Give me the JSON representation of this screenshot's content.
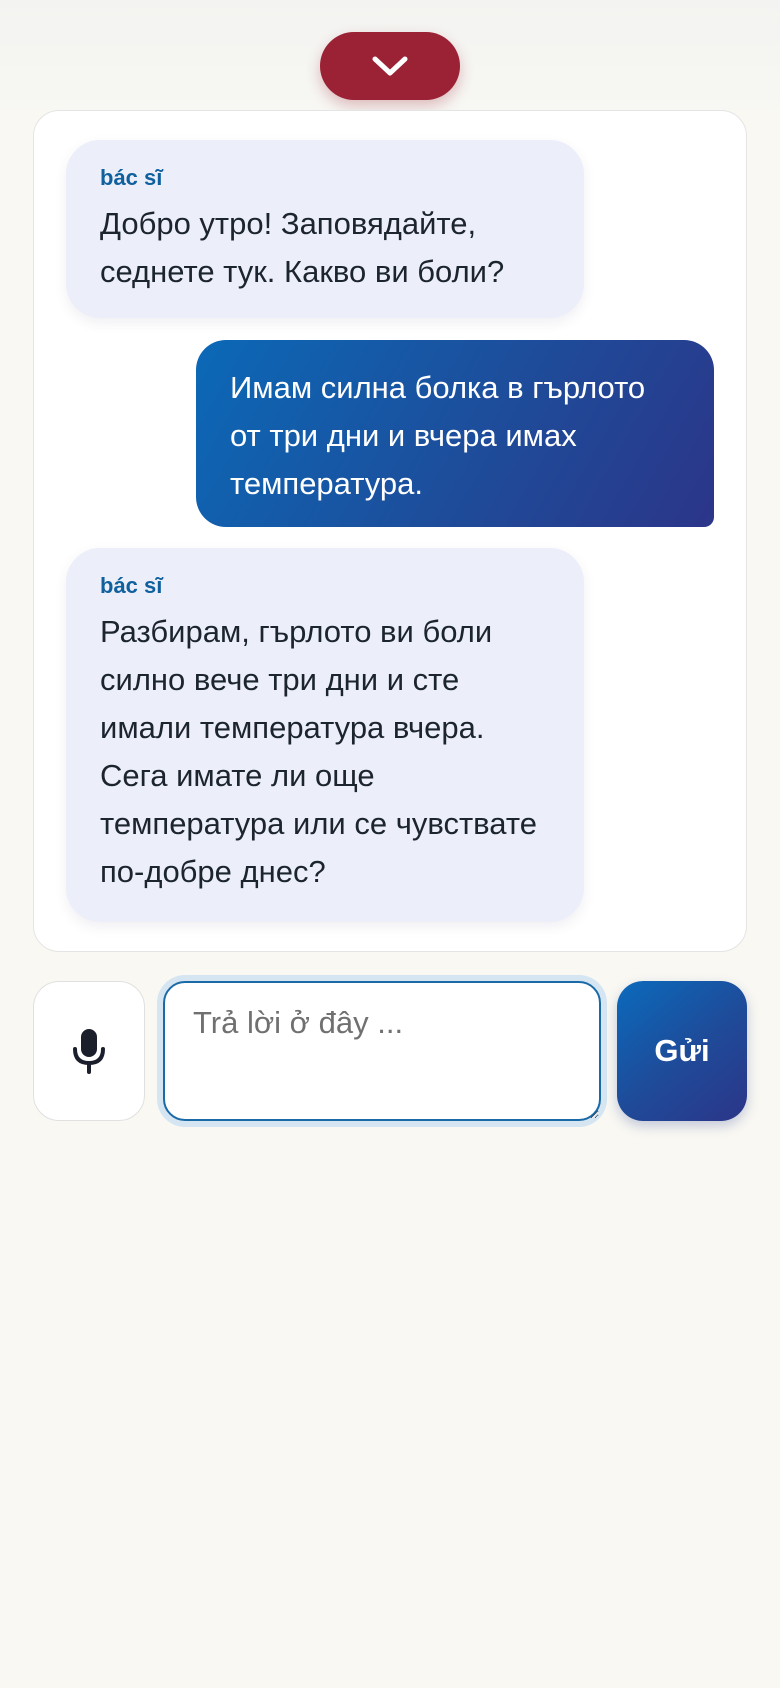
{
  "header": {
    "collapse_icon": "chevron-down-icon"
  },
  "conversation": {
    "messages": [
      {
        "role": "doctor",
        "sender": "bác sĩ",
        "text": "Добро утро! Заповядайте, седнете тук. Какво ви боли?"
      },
      {
        "role": "user",
        "text": "Имам силна болка в гърлото от три дни и вчера имах температура."
      },
      {
        "role": "doctor",
        "sender": "bác sĩ",
        "text": "Разбирам, гърлото ви боли силно вече три дни и сте имали температура вчера. Сега имате ли още температура или се чувствате по-добре днес?"
      }
    ]
  },
  "composer": {
    "mic_icon": "microphone-icon",
    "reply_placeholder": "Trả lời ở đây ...",
    "reply_value": "",
    "send_label": "Gửi"
  },
  "colors": {
    "collapse_button": "#9b2134",
    "doctor_bubble": "#eceff9",
    "sender_label": "#10609e",
    "user_bubble_start": "#0b69b7",
    "user_bubble_end": "#2c3589",
    "page_background": "#f9f8f3"
  }
}
